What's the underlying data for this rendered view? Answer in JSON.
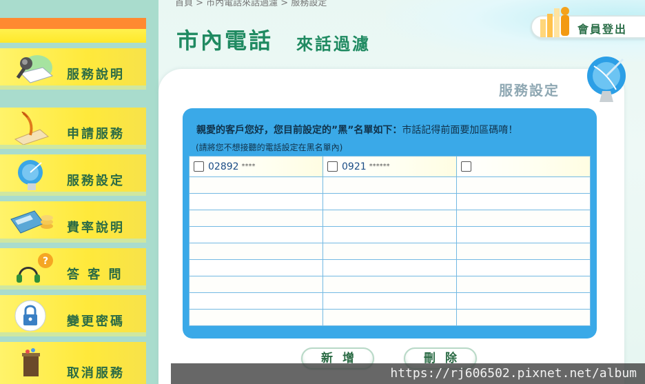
{
  "breadcrumb": "首頁 > 市內電話來話過濾 > 服務設定",
  "header": {
    "title": "市內電話",
    "subtitle": "來話過濾",
    "logout_label": "會員登出"
  },
  "sidebar": {
    "items": [
      {
        "label": "服務說明",
        "icon": "microphone-book-icon"
      },
      {
        "label": "申請服務",
        "icon": "quill-scroll-icon"
      },
      {
        "label": "服務設定",
        "icon": "satellite-dish-icon"
      },
      {
        "label": "費率說明",
        "icon": "calculator-coins-icon"
      },
      {
        "label": "答 客 問",
        "icon": "headset-question-icon"
      },
      {
        "label": "變更密碼",
        "icon": "padlock-icon"
      },
      {
        "label": "取消服務",
        "icon": "trash-bin-icon"
      }
    ]
  },
  "main": {
    "section_title": "服務設定",
    "heading": "親愛的客戶您好，您目前設定的”黑”名單如下：",
    "heading_note": "市話記得前面要加區碼唷！",
    "subnote": "(請將您不想接聽的電話設定在黑名單內)",
    "entries": [
      {
        "number": "02892",
        "masked": "****"
      },
      {
        "number": "0921",
        "masked": "******"
      },
      {
        "number": "",
        "masked": ""
      }
    ],
    "add_label": "新增",
    "delete_label": "刪除"
  },
  "watermark": "https://rj606502.pixnet.net/album",
  "colors": {
    "sidebar_bg": "#a9dccd",
    "menu_yellow": "#ffe93b",
    "title_green": "#1f8a61",
    "panel_blue": "#3aa9e8",
    "text_green": "#2b6b45"
  }
}
